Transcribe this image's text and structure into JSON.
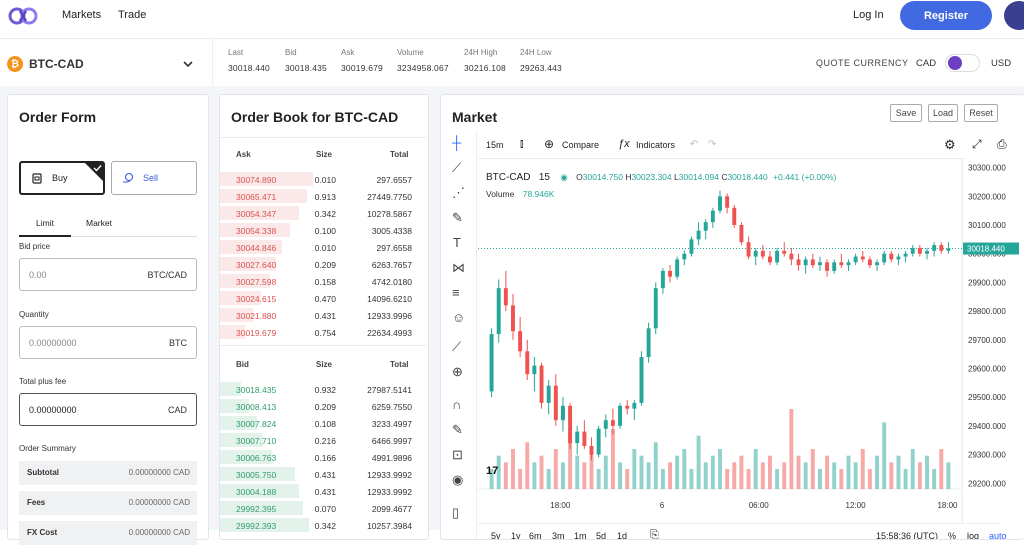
{
  "nav": {
    "markets": "Markets",
    "trade": "Trade",
    "login": "Log In",
    "register": "Register"
  },
  "ticker": {
    "pair": "BTC-CAD",
    "btc_symbol": "₿",
    "stats": [
      {
        "label": "Last",
        "value": "30018.440"
      },
      {
        "label": "Bid",
        "value": "30018.435"
      },
      {
        "label": "Ask",
        "value": "30019.679"
      },
      {
        "label": "Volume",
        "value": "3234958.067"
      },
      {
        "label": "24H High",
        "value": "30216.108"
      },
      {
        "label": "24H Low",
        "value": "29263.443"
      }
    ],
    "quote_label": "QUOTE CURRENCY",
    "quote_left": "CAD",
    "quote_right": "USD",
    "toggle_color": "#6c3fc4"
  },
  "order_form": {
    "title": "Order Form",
    "buy": "Buy",
    "sell": "Sell",
    "tab_limit": "Limit",
    "tab_market": "Market",
    "bid_label": "Bid price",
    "bid_value": "0.00",
    "bid_unit": "BTC/CAD",
    "qty_label": "Quantity",
    "qty_value": "0.00000000",
    "qty_unit": "BTC",
    "total_label": "Total plus fee",
    "total_value": "0.00000000",
    "total_unit": "CAD",
    "summary_label": "Order Summary",
    "summary": [
      {
        "label": "Subtotal",
        "value": "0.00000000 CAD"
      },
      {
        "label": "Fees",
        "value": "0.00000000 CAD"
      },
      {
        "label": "FX Cost",
        "value": "0.00000000 CAD"
      }
    ]
  },
  "order_book": {
    "title": "Order Book for BTC-CAD",
    "ask_headers": {
      "price": "Ask",
      "size": "Size",
      "total": "Total"
    },
    "asks": [
      {
        "price": "30074.890",
        "size": "0.010",
        "total": "297.6557",
        "depth": 0.45
      },
      {
        "price": "30065.471",
        "size": "0.913",
        "total": "27449.7750",
        "depth": 0.42
      },
      {
        "price": "30054.347",
        "size": "0.342",
        "total": "10278.5867",
        "depth": 0.38
      },
      {
        "price": "30054.338",
        "size": "0.100",
        "total": "3005.4338",
        "depth": 0.34
      },
      {
        "price": "30044.846",
        "size": "0.010",
        "total": "297.6558",
        "depth": 0.3
      },
      {
        "price": "30027.640",
        "size": "0.209",
        "total": "6263.7657",
        "depth": 0.27
      },
      {
        "price": "30027.598",
        "size": "0.158",
        "total": "4742.0180",
        "depth": 0.24
      },
      {
        "price": "30024.615",
        "size": "0.470",
        "total": "14096.6210",
        "depth": 0.2
      },
      {
        "price": "30021.880",
        "size": "0.431",
        "total": "12933.9996",
        "depth": 0.16
      },
      {
        "price": "30019.679",
        "size": "0.754",
        "total": "22634.4993",
        "depth": 0.12
      }
    ],
    "bid_headers": {
      "price": "Bid",
      "size": "Size",
      "total": "Total"
    },
    "bids": [
      {
        "price": "30018.435",
        "size": "0.932",
        "total": "27987.5141",
        "depth": 0.1
      },
      {
        "price": "30008.413",
        "size": "0.209",
        "total": "6259.7550",
        "depth": 0.14
      },
      {
        "price": "30007.824",
        "size": "0.108",
        "total": "3233.4997",
        "depth": 0.18
      },
      {
        "price": "30007.710",
        "size": "0.216",
        "total": "6466.9997",
        "depth": 0.21
      },
      {
        "price": "30006.763",
        "size": "0.166",
        "automatic": "",
        "total": "4991.9896",
        "depth": 0.25
      },
      {
        "price": "30005.750",
        "size": "0.431",
        "total": "12933.9992",
        "depth": 0.36
      },
      {
        "price": "30004.188",
        "size": "0.431",
        "total": "12933.9992",
        "depth": 0.38
      },
      {
        "price": "29992.395",
        "size": "0.070",
        "total": "2099.4677",
        "depth": 0.4
      },
      {
        "price": "29992.393",
        "size": "0.342",
        "total": "10257.3984",
        "depth": 0.43
      }
    ],
    "ask_color": "#d9534f",
    "bid_color": "#2e9e6a"
  },
  "market": {
    "title": "Market",
    "save": "Save",
    "load": "Load",
    "reset": "Reset",
    "interval": "15m",
    "compare": "Compare",
    "indicators": "Indicators",
    "legend": {
      "pair": "BTC-CAD",
      "interval": "15",
      "o_label": "O",
      "o": "30014.750",
      "h_label": "H",
      "h": "30023.304",
      "l_label": "L",
      "l": "30014.094",
      "c_label": "C",
      "c": "30018.440",
      "change": "+0.441 (+0.00%)",
      "volume_label": "Volume",
      "volume": "78.946K"
    },
    "current_price": "30018.440",
    "timeframes": [
      "5y",
      "1y",
      "6m",
      "3m",
      "1m",
      "5d",
      "1d"
    ],
    "time": "15:58:36 (UTC)",
    "pct": "%",
    "log": "log",
    "auto": "auto"
  },
  "chart_data": {
    "type": "candlestick",
    "ylim": [
      29180,
      30330
    ],
    "y_ticks": [
      "30300.000",
      "30200.000",
      "30100.000",
      "30000.000",
      "29900.000",
      "29800.000",
      "29700.000",
      "29600.000",
      "29500.000",
      "29400.000",
      "29300.000",
      "29200.000"
    ],
    "x_ticks": [
      "18:00",
      "6",
      "06:00",
      "12:00",
      "18:00"
    ],
    "up_color": "#26a69a",
    "down_color": "#ef5350",
    "candles": [
      [
        29520,
        29740,
        29500,
        29720
      ],
      [
        29720,
        29910,
        29690,
        29880
      ],
      [
        29880,
        29940,
        29800,
        29820
      ],
      [
        29820,
        29860,
        29700,
        29730
      ],
      [
        29730,
        29780,
        29640,
        29660
      ],
      [
        29660,
        29700,
        29560,
        29580
      ],
      [
        29580,
        29640,
        29520,
        29610
      ],
      [
        29610,
        29620,
        29460,
        29480
      ],
      [
        29480,
        29560,
        29440,
        29540
      ],
      [
        29540,
        29580,
        29400,
        29420
      ],
      [
        29420,
        29500,
        29380,
        29470
      ],
      [
        29470,
        29480,
        29320,
        29340
      ],
      [
        29340,
        29400,
        29300,
        29380
      ],
      [
        29380,
        29420,
        29320,
        29330
      ],
      [
        29330,
        29360,
        29280,
        29300
      ],
      [
        29300,
        29400,
        29290,
        29390
      ],
      [
        29390,
        29440,
        29360,
        29420
      ],
      [
        29420,
        29460,
        29370,
        29400
      ],
      [
        29400,
        29480,
        29390,
        29470
      ],
      [
        29470,
        29490,
        29440,
        29460
      ],
      [
        29460,
        29490,
        29420,
        29480
      ],
      [
        29480,
        29660,
        29470,
        29640
      ],
      [
        29640,
        29760,
        29620,
        29740
      ],
      [
        29740,
        29900,
        29720,
        29880
      ],
      [
        29880,
        29950,
        29860,
        29940
      ],
      [
        29940,
        29960,
        29900,
        29920
      ],
      [
        29920,
        29990,
        29910,
        29980
      ],
      [
        29980,
        30010,
        29960,
        30000
      ],
      [
        30000,
        30060,
        29990,
        30050
      ],
      [
        30050,
        30110,
        30030,
        30080
      ],
      [
        30080,
        30120,
        30050,
        30110
      ],
      [
        30110,
        30160,
        30090,
        30150
      ],
      [
        30150,
        30220,
        30140,
        30200
      ],
      [
        30200,
        30210,
        30140,
        30160
      ],
      [
        30160,
        30170,
        30090,
        30100
      ],
      [
        30100,
        30110,
        30030,
        30040
      ],
      [
        30040,
        30060,
        29980,
        29990
      ],
      [
        29990,
        30020,
        29960,
        30010
      ],
      [
        30010,
        30030,
        29980,
        29990
      ],
      [
        29990,
        30010,
        29960,
        29970
      ],
      [
        29970,
        30020,
        29960,
        30010
      ],
      [
        30010,
        30040,
        29990,
        30000
      ],
      [
        30000,
        30020,
        29960,
        29980
      ],
      [
        29980,
        30000,
        29940,
        29960
      ],
      [
        29960,
        29990,
        29930,
        29980
      ],
      [
        29980,
        30000,
        29950,
        29960
      ],
      [
        29960,
        29990,
        29940,
        29970
      ],
      [
        29970,
        29980,
        29920,
        29940
      ],
      [
        29940,
        29980,
        29930,
        29970
      ],
      [
        29970,
        30000,
        29950,
        29960
      ],
      [
        29960,
        29980,
        29940,
        29970
      ],
      [
        29970,
        30000,
        29960,
        29990
      ],
      [
        29990,
        30010,
        29970,
        29980
      ],
      [
        29980,
        29990,
        29950,
        29960
      ],
      [
        29960,
        29980,
        29940,
        29970
      ],
      [
        29970,
        30010,
        29960,
        30000
      ],
      [
        30000,
        30010,
        29970,
        29980
      ],
      [
        29980,
        30000,
        29960,
        29990
      ],
      [
        29990,
        30010,
        29970,
        30000
      ],
      [
        30000,
        30030,
        29990,
        30020
      ],
      [
        30020,
        30030,
        29990,
        30000
      ],
      [
        30000,
        30020,
        29980,
        30010
      ],
      [
        30010,
        30040,
        29990,
        30030
      ],
      [
        30030,
        30040,
        30000,
        30010
      ],
      [
        30010,
        30040,
        30000,
        30018
      ]
    ],
    "volumes": [
      3,
      5,
      4,
      6,
      3,
      7,
      4,
      5,
      3,
      6,
      4,
      8,
      5,
      4,
      6,
      3,
      5,
      9,
      4,
      3,
      6,
      5,
      4,
      7,
      3,
      4,
      5,
      6,
      3,
      8,
      4,
      5,
      6,
      3,
      4,
      5,
      3,
      6,
      4,
      5,
      3,
      4,
      12,
      5,
      4,
      6,
      3,
      5,
      4,
      3,
      5,
      4,
      6,
      3,
      5,
      10,
      4,
      5,
      3,
      6,
      4,
      5,
      3,
      6,
      4
    ]
  }
}
